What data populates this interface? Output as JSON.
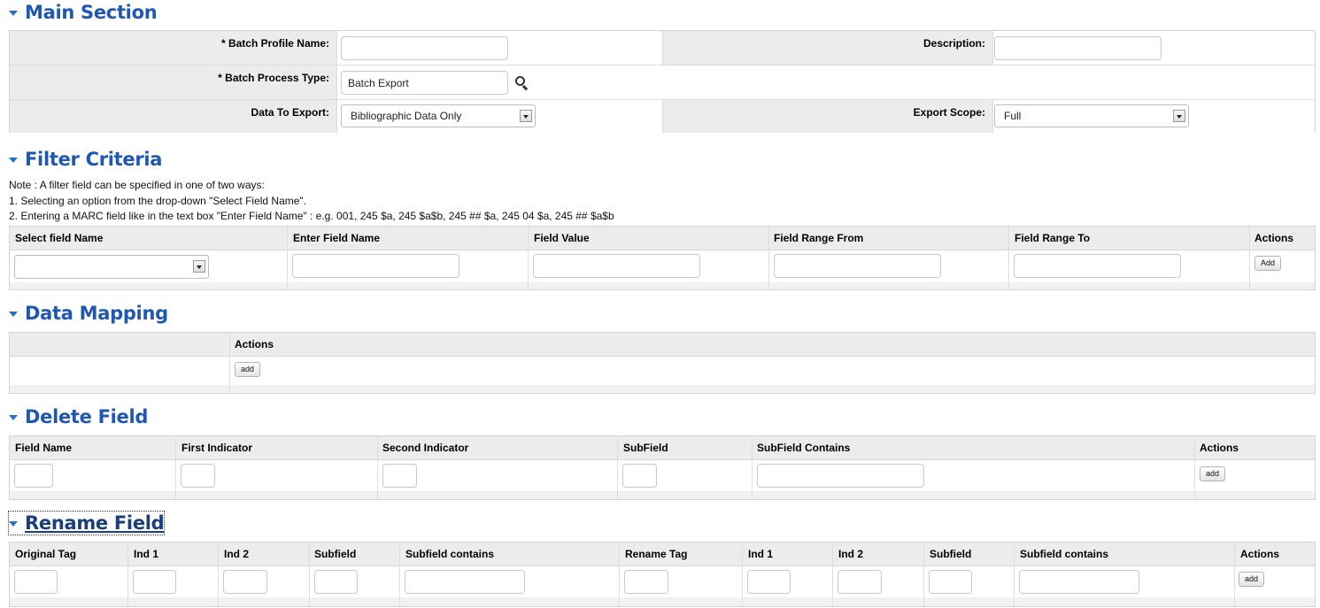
{
  "main_section": {
    "title": "Main Section",
    "batch_profile_name_label": "* Batch Profile Name:",
    "batch_profile_name_value": "",
    "description_label": "Description:",
    "description_value": "",
    "batch_process_type_label": "* Batch Process Type:",
    "batch_process_type_value": "Batch Export",
    "data_to_export_label": "Data To Export:",
    "data_to_export_value": "Bibliographic Data Only",
    "export_scope_label": "Export Scope:",
    "export_scope_value": "Full"
  },
  "filter_criteria": {
    "title": "Filter Criteria",
    "note_lines": [
      "Note : A filter field can be specified in one of two ways:",
      "1. Selecting an option from the drop-down \"Select Field Name\".",
      "2. Entering a MARC field like in the text box \"Enter Field Name\" : e.g. 001, 245 $a, 245 $a$b, 245 ## $a, 245 04 $a, 245 ## $a$b"
    ],
    "columns": [
      "Select field Name",
      "Enter Field Name",
      "Field Value",
      "Field Range From",
      "Field Range To",
      "Actions"
    ],
    "select_value": "",
    "add_label": "Add"
  },
  "data_mapping": {
    "title": "Data Mapping",
    "columns": [
      "",
      "Actions"
    ],
    "add_label": "add"
  },
  "delete_field": {
    "title": "Delete Field",
    "columns": [
      "Field Name",
      "First Indicator",
      "Second Indicator",
      "SubField",
      "SubField Contains",
      "Actions"
    ],
    "add_label": "add"
  },
  "rename_field": {
    "title": "Rename Field",
    "columns": [
      "Original Tag",
      "Ind 1",
      "Ind 2",
      "Subfield",
      "Subfield contains",
      "Rename Tag",
      "Ind 1",
      "Ind 2",
      "Subfield",
      "Subfield contains",
      "Actions"
    ],
    "add_label": "add"
  },
  "colors": {
    "section_title": "#1e57b4",
    "triangle": "#2a6fc2",
    "label_bg": "#ececec",
    "border": "#d4d4d4"
  },
  "icons": {
    "section_toggle": "triangle-down-icon",
    "lookup": "search-icon",
    "dropdown": "chevron-down-icon"
  }
}
